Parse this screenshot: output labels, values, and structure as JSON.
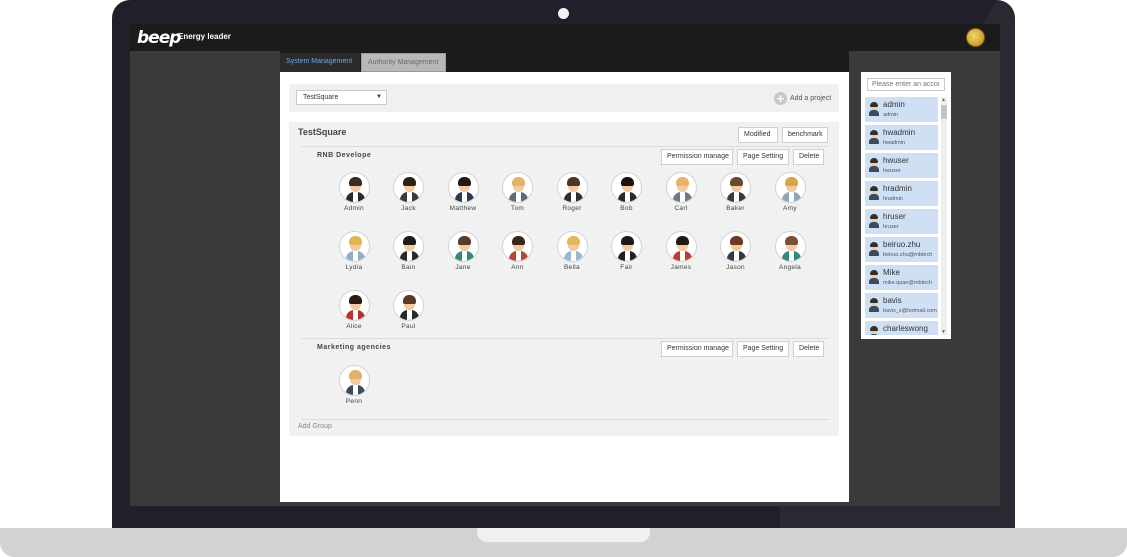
{
  "header": {
    "logo_text": "beep",
    "app_title": "Energy leader"
  },
  "tabs": [
    {
      "label": "System Management",
      "active": true
    },
    {
      "label": "Authority Management",
      "active": false
    }
  ],
  "project": {
    "selected": "TestSquare",
    "add_label": "Add a project",
    "add_icon": "plus-circle-icon",
    "name": "TestSquare",
    "modified_label": "Modified",
    "benchmark_label": "benchmark",
    "add_group_label": "Add Group"
  },
  "groups": [
    {
      "name": "RNB Develope",
      "permission_label": "Permission manage",
      "page_setting_label": "Page Setting",
      "delete_label": "Delete",
      "members": [
        {
          "name": "Admin",
          "hair": "#3a2c22",
          "body": "#2b2b2b"
        },
        {
          "name": "Jack",
          "hair": "#2b2118",
          "body": "#3b3b3b"
        },
        {
          "name": "Matthew",
          "hair": "#1f1a16",
          "body": "#2a3b52"
        },
        {
          "name": "Tom",
          "hair": "#e0b26a",
          "body": "#5b6b7b"
        },
        {
          "name": "Roger",
          "hair": "#4a3626",
          "body": "#2f2f2f"
        },
        {
          "name": "Bob",
          "hair": "#1a1410",
          "body": "#2a2a2a"
        },
        {
          "name": "Carl",
          "hair": "#e6b36a",
          "body": "#6b7b8b"
        },
        {
          "name": "Baker",
          "hair": "#6a4a2a",
          "body": "#3a3a3a"
        },
        {
          "name": "Amy",
          "hair": "#d9a548",
          "body": "#8fa6b8"
        },
        {
          "name": "Lydia",
          "hair": "#e0b44e",
          "body": "#8fb0c8"
        },
        {
          "name": "Bain",
          "hair": "#1f1a16",
          "body": "#2a2a2a"
        },
        {
          "name": "Jane",
          "hair": "#5a3a26",
          "body": "#2f8a7a"
        },
        {
          "name": "Ann",
          "hair": "#3b2418",
          "body": "#b8443a"
        },
        {
          "name": "Bella",
          "hair": "#e6b55a",
          "body": "#9ab8cc"
        },
        {
          "name": "Fair",
          "hair": "#1f1a16",
          "body": "#222222"
        },
        {
          "name": "James",
          "hair": "#1f1a16",
          "body": "#c03a34"
        },
        {
          "name": "Jason",
          "hair": "#6a3a22",
          "body": "#2e3b4b"
        },
        {
          "name": "Angela",
          "hair": "#7a5034",
          "body": "#2f8a7a"
        },
        {
          "name": "Alice",
          "hair": "#2a1a12",
          "body": "#b8322e"
        },
        {
          "name": "Paul",
          "hair": "#5a3a22",
          "body": "#2a2a2a"
        }
      ]
    },
    {
      "name": "Marketing agencies",
      "permission_label": "Permission manage",
      "page_setting_label": "Page Setting",
      "delete_label": "Delete",
      "members": [
        {
          "name": "Penn",
          "hair": "#e0b26a",
          "body": "#3b4a5c"
        }
      ]
    }
  ],
  "accounts": {
    "search_placeholder": "Please enter an accou",
    "items": [
      {
        "name": "admin",
        "login": "admin"
      },
      {
        "name": "hwadmin",
        "login": "hwadmin"
      },
      {
        "name": "hwuser",
        "login": "hwuser"
      },
      {
        "name": "hradmin",
        "login": "hradmin"
      },
      {
        "name": "hruser",
        "login": "hruser"
      },
      {
        "name": "beiruo.zhu",
        "login": "beiruo.zhu@mbtech"
      },
      {
        "name": "Mike",
        "login": "mike.quan@mbtech"
      },
      {
        "name": "bavis",
        "login": "bavis_z@hotmail.com"
      },
      {
        "name": "charleswong",
        "login": ""
      }
    ]
  },
  "colors": {
    "accent_tab": "#6ea8e6",
    "account_item_bg": "#cfe0f5"
  }
}
